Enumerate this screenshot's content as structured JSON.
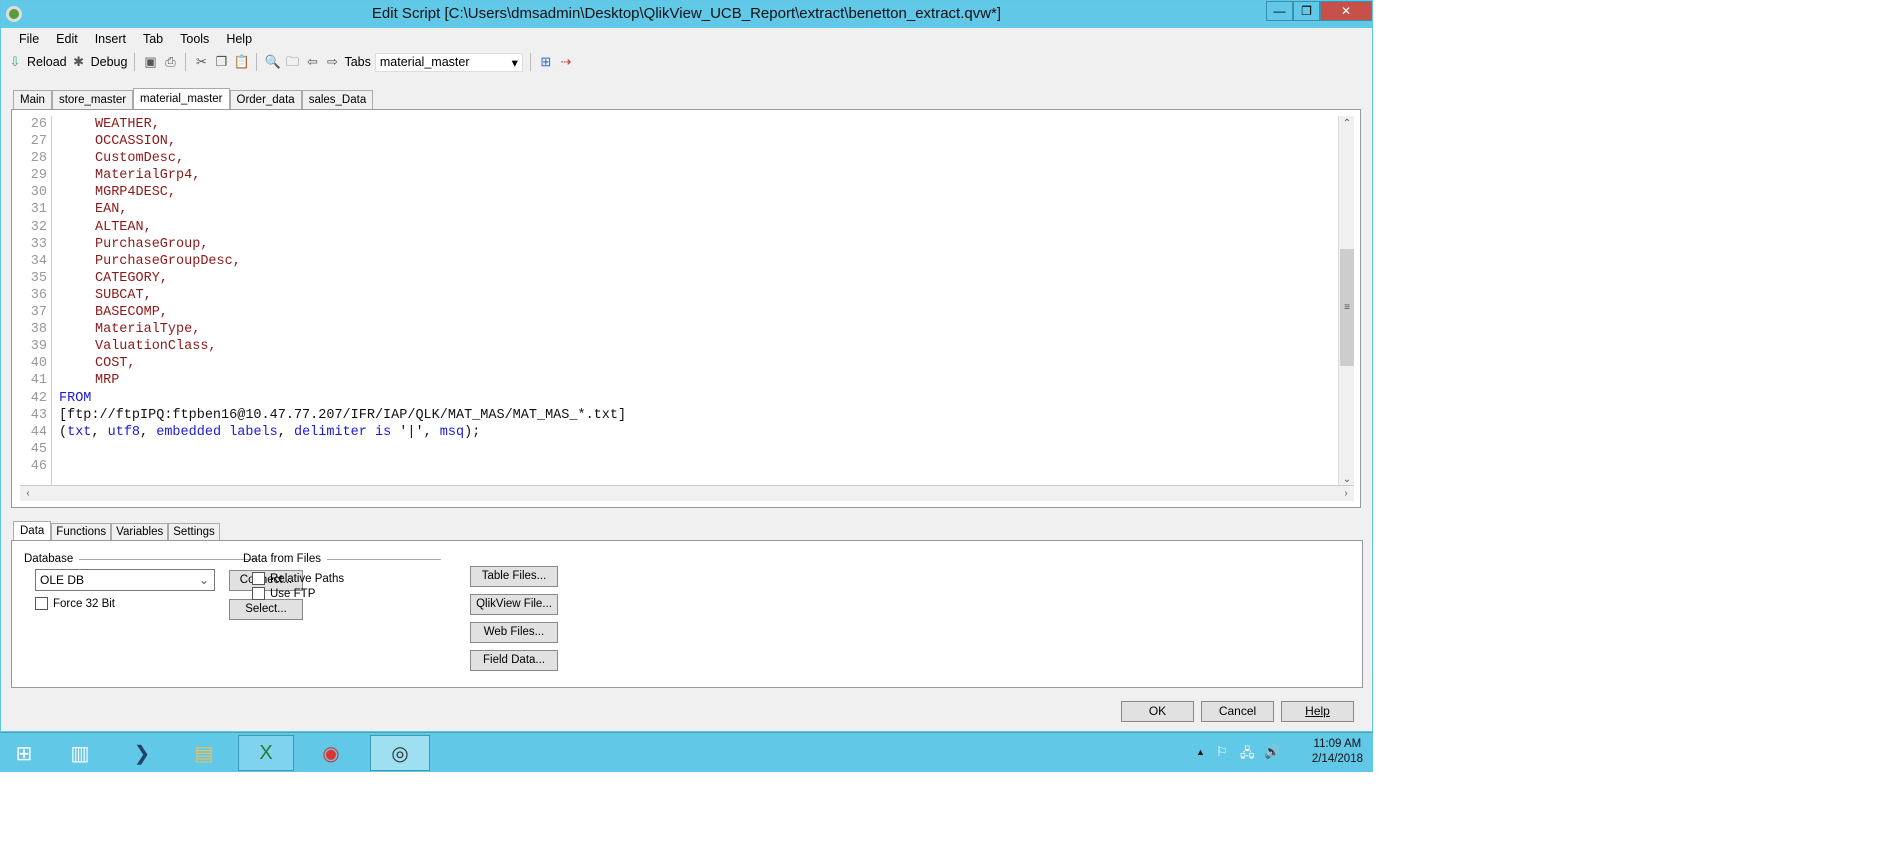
{
  "window": {
    "title": "Edit Script [C:\\Users\\dmsadmin\\Desktop\\QlikView_UCB_Report\\extract\\benetton_extract.qvw*]",
    "min": "—",
    "max": "❐",
    "close": "✕"
  },
  "menu": [
    "File",
    "Edit",
    "Insert",
    "Tab",
    "Tools",
    "Help"
  ],
  "toolbar": {
    "reload": "Reload",
    "debug": "Debug",
    "tabs_label": "Tabs",
    "tabs_value": "material_master"
  },
  "script_tabs": [
    "Main",
    "store_master",
    "material_master",
    "Order_data",
    "sales_Data"
  ],
  "editor": {
    "line_numbers": [
      "26",
      "27",
      "28",
      "29",
      "30",
      "31",
      "32",
      "33",
      "34",
      "35",
      "36",
      "37",
      "38",
      "39",
      "40",
      "41",
      "42",
      "43",
      "44",
      "45",
      "46"
    ],
    "fields": [
      "WEATHER,",
      "OCCASSION,",
      "CustomDesc,",
      "MaterialGrp4,",
      "MGRP4DESC,",
      "EAN,",
      "ALTEAN,",
      "PurchaseGroup,",
      "PurchaseGroupDesc,",
      "CATEGORY,",
      "SUBCAT,",
      "BASECOMP,",
      "MaterialType,",
      "ValuationClass,",
      "COST,",
      "MRP"
    ],
    "from": "FROM",
    "path": "[ftp://ftpIPQ:ftpben16@10.47.77.207/IFR/IAP/QLK/MAT_MAS/MAT_MAS_*.txt]",
    "opts": {
      "open": "(",
      "txt": "txt",
      "c1": ", ",
      "utf8": "utf8",
      "c2": ", ",
      "emb": "embedded labels",
      "c3": ", ",
      "delim": "delimiter is",
      "q": " '|', ",
      "msq": "msq",
      "close": ");"
    }
  },
  "bottom_tabs": [
    "Data",
    "Functions",
    "Variables",
    "Settings"
  ],
  "data_panel": {
    "database_label": "Database",
    "database_value": "OLE DB",
    "force32": "Force 32 Bit",
    "connect": "Connect...",
    "select": "Select...",
    "files_label": "Data from Files",
    "relative_paths": "Relative Paths",
    "use_ftp": "Use FTP",
    "table_files": "Table Files...",
    "qlikview_file": "QlikView File...",
    "web_files": "Web Files...",
    "field_data": "Field Data..."
  },
  "dialog": {
    "ok": "OK",
    "cancel": "Cancel",
    "help": "Help"
  },
  "taskbar": {
    "time": "11:09 AM",
    "date": "2/14/2018"
  }
}
